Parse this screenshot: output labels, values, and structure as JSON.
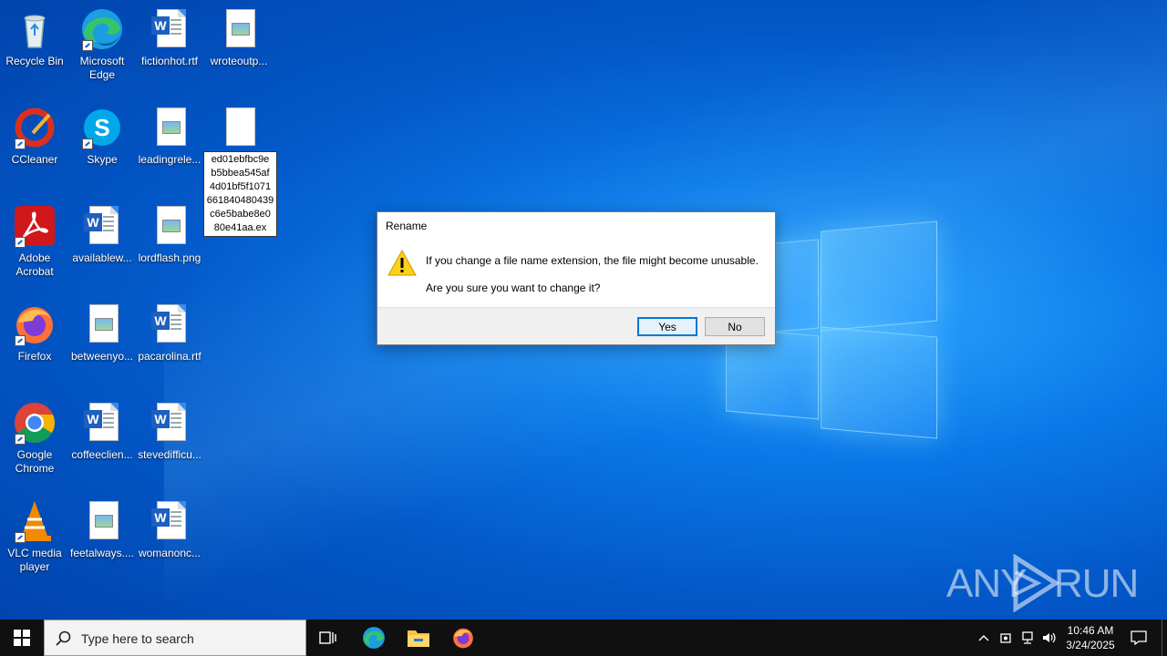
{
  "desktop_icons": {
    "recycle_bin": "Recycle Bin",
    "edge": "Microsoft Edge",
    "fictionhot": "fictionhot.rtf",
    "wroteoutp": "wroteoutp...",
    "ccleaner": "CCleaner",
    "skype": "Skype",
    "leadingrele": "leadingrele...",
    "rename_text": "ed01ebfbc9e b5bbea545af 4d01bf5f1071 661840480439 c6e5babe8e0 80e41aa.ex",
    "acrobat": "Adobe Acrobat",
    "availablew": "availablew...",
    "lordflash": "lordflash.png",
    "firefox": "Firefox",
    "betweenyo": "betweenyo...",
    "pacarolina": "pacarolina.rtf",
    "chrome": "Google Chrome",
    "coffeeclien": "coffeeclien...",
    "stevedifficu": "stevedifficu...",
    "vlc": "VLC media player",
    "feetalways": "feetalways....",
    "womanonc": "womanonc..."
  },
  "dialog": {
    "title": "Rename",
    "message1": "If you change a file name extension, the file might become unusable.",
    "message2": "Are you sure you want to change it?",
    "yes_label": "Yes",
    "no_label": "No",
    "icon": "warning-icon"
  },
  "watermark": {
    "left": "ANY",
    "right": "RUN"
  },
  "taskbar": {
    "search_placeholder": "Type here to search",
    "time": "10:46 AM",
    "date": "3/24/2025"
  },
  "colors": {
    "accent": "#0078d7",
    "taskbar": "#101010",
    "desktop": "#0a78e8"
  }
}
